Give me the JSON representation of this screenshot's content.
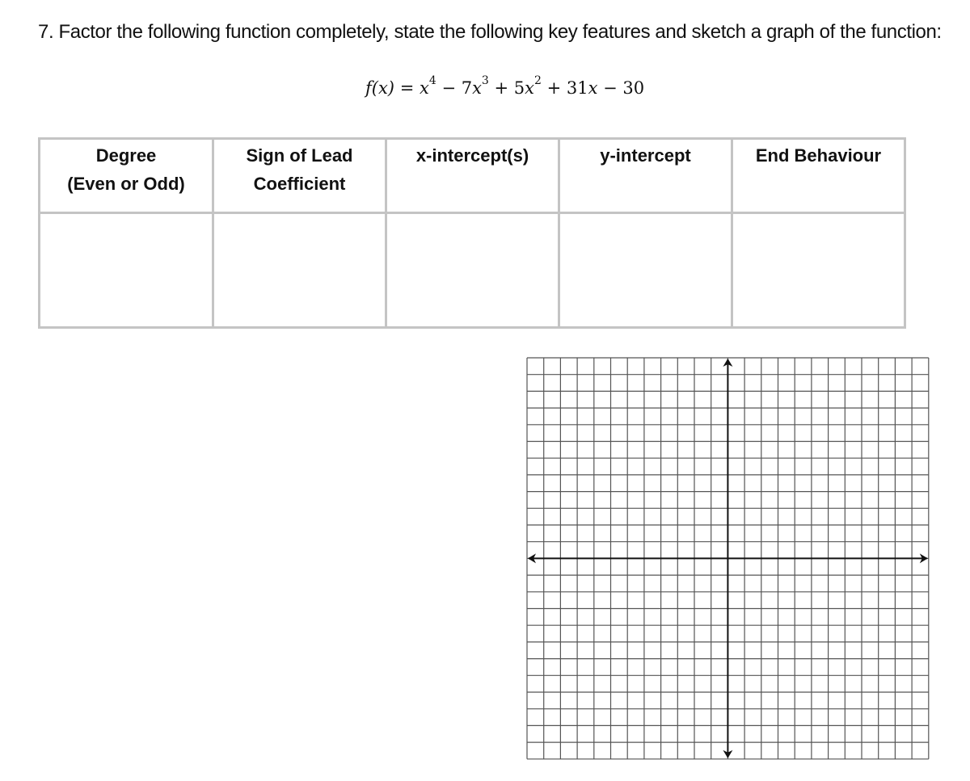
{
  "question": {
    "text": "7. Factor the following function completely, state the following key features and sketch a graph of the function:",
    "formula": {
      "lhs": "f(x)",
      "eq": "=",
      "terms": [
        {
          "coef": "",
          "var": "x",
          "exp": "4",
          "op": ""
        },
        {
          "coef": "7",
          "var": "x",
          "exp": "3",
          "op": "−"
        },
        {
          "coef": "5",
          "var": "x",
          "exp": "2",
          "op": "+"
        },
        {
          "coef": "31",
          "var": "x",
          "exp": "",
          "op": "+"
        },
        {
          "coef": "30",
          "var": "",
          "exp": "",
          "op": "−"
        }
      ]
    }
  },
  "table": {
    "headers": [
      {
        "line1": "Degree",
        "line2": "(Even or Odd)"
      },
      {
        "line1": "Sign of Lead",
        "line2": "Coefficient"
      },
      {
        "line1": "x-intercept(s)",
        "line2": ""
      },
      {
        "line1": "y-intercept",
        "line2": ""
      },
      {
        "line1": "End Behaviour",
        "line2": ""
      }
    ],
    "answers": [
      "",
      "",
      "",
      "",
      ""
    ]
  },
  "graph": {
    "columns": 24,
    "rows": 24,
    "grid_color": "#555555",
    "axis_color": "#111111"
  }
}
